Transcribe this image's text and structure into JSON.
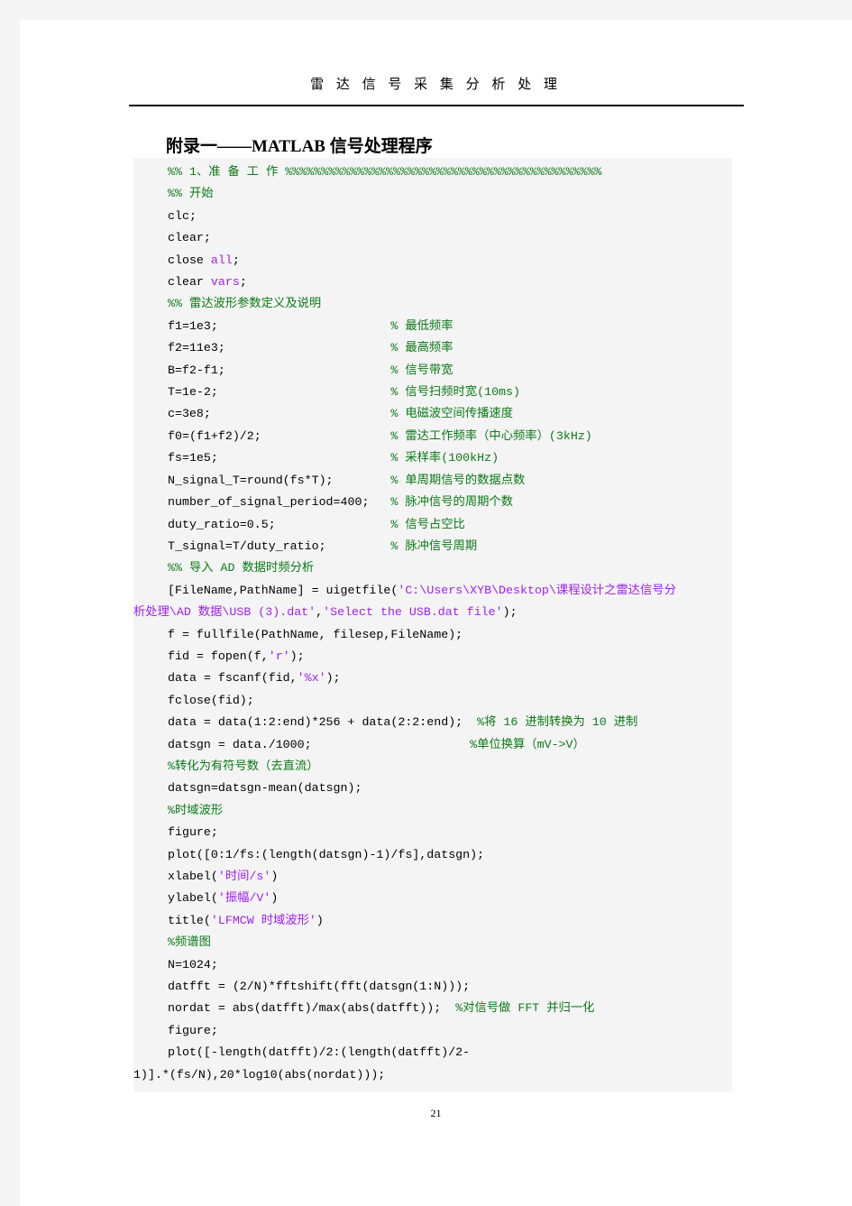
{
  "page": {
    "running_header": "雷 达 信 号 采 集 分 析 处 理",
    "section_title": "附录一——MATLAB 信号处理程序",
    "page_number": "21"
  },
  "colors": {
    "comment_green": "#0b7a17",
    "string_purple": "#a020f0",
    "code_black": "#000000",
    "code_background": "#f4f4f4",
    "page_background": "#ffffff"
  },
  "code": {
    "language": "MATLAB",
    "lines": [
      {
        "id": 1,
        "indent": "normal",
        "segments": [
          {
            "t": "comment",
            "v": "%% 1、准 备 工 作 %%%%%%%%%%%%%%%%%%%%%%%%%%%%%%%%%%%%%%%%%%%%"
          }
        ]
      },
      {
        "id": 2,
        "indent": "normal",
        "segments": [
          {
            "t": "comment",
            "v": "%% 开始"
          }
        ]
      },
      {
        "id": 3,
        "indent": "normal",
        "segments": [
          {
            "t": "code",
            "v": "clc;"
          }
        ]
      },
      {
        "id": 4,
        "indent": "normal",
        "segments": [
          {
            "t": "code",
            "v": "clear;"
          }
        ]
      },
      {
        "id": 5,
        "indent": "normal",
        "segments": [
          {
            "t": "code",
            "v": "close "
          },
          {
            "t": "keyword",
            "v": "all"
          },
          {
            "t": "code",
            "v": ";"
          }
        ]
      },
      {
        "id": 6,
        "indent": "normal",
        "segments": [
          {
            "t": "code",
            "v": "clear "
          },
          {
            "t": "keyword",
            "v": "vars"
          },
          {
            "t": "code",
            "v": ";"
          }
        ]
      },
      {
        "id": 7,
        "indent": "normal",
        "segments": [
          {
            "t": "comment",
            "v": "%% 雷达波形参数定义及说明"
          }
        ]
      },
      {
        "id": 8,
        "indent": "normal",
        "segments": [
          {
            "t": "code",
            "v": "f1=1e3;                        "
          },
          {
            "t": "comment",
            "v": "% 最低频率"
          }
        ]
      },
      {
        "id": 9,
        "indent": "normal",
        "segments": [
          {
            "t": "code",
            "v": "f2=11e3;                       "
          },
          {
            "t": "comment",
            "v": "% 最高频率"
          }
        ]
      },
      {
        "id": 10,
        "indent": "normal",
        "segments": [
          {
            "t": "code",
            "v": "B=f2-f1;                       "
          },
          {
            "t": "comment",
            "v": "% 信号带宽"
          }
        ]
      },
      {
        "id": 11,
        "indent": "normal",
        "segments": [
          {
            "t": "code",
            "v": "T=1e-2;                        "
          },
          {
            "t": "comment",
            "v": "% 信号扫频时宽(10ms)"
          }
        ]
      },
      {
        "id": 12,
        "indent": "normal",
        "segments": [
          {
            "t": "code",
            "v": "c=3e8;                         "
          },
          {
            "t": "comment",
            "v": "% 电磁波空间传播速度"
          }
        ]
      },
      {
        "id": 13,
        "indent": "normal",
        "segments": [
          {
            "t": "code",
            "v": "f0=(f1+f2)/2;                  "
          },
          {
            "t": "comment",
            "v": "% 雷达工作频率（中心频率）(3kHz)"
          }
        ]
      },
      {
        "id": 14,
        "indent": "normal",
        "segments": [
          {
            "t": "code",
            "v": "fs=1e5;                        "
          },
          {
            "t": "comment",
            "v": "% 采样率(100kHz)"
          }
        ]
      },
      {
        "id": 15,
        "indent": "normal",
        "segments": [
          {
            "t": "code",
            "v": "N_signal_T=round(fs*T);        "
          },
          {
            "t": "comment",
            "v": "% 单周期信号的数据点数"
          }
        ]
      },
      {
        "id": 16,
        "indent": "normal",
        "segments": [
          {
            "t": "code",
            "v": "number_of_signal_period=400;   "
          },
          {
            "t": "comment",
            "v": "% 脉冲信号的周期个数"
          }
        ]
      },
      {
        "id": 17,
        "indent": "normal",
        "segments": [
          {
            "t": "code",
            "v": "duty_ratio=0.5;                "
          },
          {
            "t": "comment",
            "v": "% 信号占空比"
          }
        ]
      },
      {
        "id": 18,
        "indent": "normal",
        "segments": [
          {
            "t": "code",
            "v": "T_signal=T/duty_ratio;         "
          },
          {
            "t": "comment",
            "v": "% 脉冲信号周期"
          }
        ]
      },
      {
        "id": 19,
        "indent": "normal",
        "segments": [
          {
            "t": "comment",
            "v": "%% 导入 AD 数据时频分析"
          }
        ]
      },
      {
        "id": 20,
        "indent": "normal",
        "segments": [
          {
            "t": "code",
            "v": "[FileName,PathName] = uigetfile("
          },
          {
            "t": "string",
            "v": "'C:\\Users\\XYB\\Desktop\\课程设计之雷达信号分"
          }
        ]
      },
      {
        "id": 21,
        "indent": "wrap",
        "segments": [
          {
            "t": "string",
            "v": "析处理\\AD 数据\\USB (3).dat'"
          },
          {
            "t": "code",
            "v": ","
          },
          {
            "t": "string",
            "v": "'Select the USB.dat file'"
          },
          {
            "t": "code",
            "v": ");"
          }
        ]
      },
      {
        "id": 22,
        "indent": "normal",
        "segments": [
          {
            "t": "code",
            "v": "f = fullfile(PathName, filesep,FileName);"
          }
        ]
      },
      {
        "id": 23,
        "indent": "normal",
        "segments": [
          {
            "t": "code",
            "v": "fid = fopen(f,"
          },
          {
            "t": "string",
            "v": "'r'"
          },
          {
            "t": "code",
            "v": ");"
          }
        ]
      },
      {
        "id": 24,
        "indent": "normal",
        "segments": [
          {
            "t": "code",
            "v": "data = fscanf(fid,"
          },
          {
            "t": "string",
            "v": "'%x'"
          },
          {
            "t": "code",
            "v": ");"
          }
        ]
      },
      {
        "id": 25,
        "indent": "normal",
        "segments": [
          {
            "t": "code",
            "v": "fclose(fid);"
          }
        ]
      },
      {
        "id": 26,
        "indent": "normal",
        "segments": [
          {
            "t": "code",
            "v": "data = data(1:2:end)*256 + data(2:2:end);  "
          },
          {
            "t": "comment",
            "v": "%将 16 进制转换为 10 进制"
          }
        ]
      },
      {
        "id": 27,
        "indent": "normal",
        "segments": [
          {
            "t": "code",
            "v": "datsgn = data./1000;                      "
          },
          {
            "t": "comment",
            "v": "%单位换算（mV->V）"
          }
        ]
      },
      {
        "id": 28,
        "indent": "normal",
        "segments": [
          {
            "t": "comment",
            "v": "%转化为有符号数（去直流）"
          }
        ]
      },
      {
        "id": 29,
        "indent": "normal",
        "segments": [
          {
            "t": "code",
            "v": "datsgn=datsgn-mean(datsgn);"
          }
        ]
      },
      {
        "id": 30,
        "indent": "normal",
        "segments": [
          {
            "t": "comment",
            "v": "%时域波形"
          }
        ]
      },
      {
        "id": 31,
        "indent": "normal",
        "segments": [
          {
            "t": "code",
            "v": "figure;"
          }
        ]
      },
      {
        "id": 32,
        "indent": "normal",
        "segments": [
          {
            "t": "code",
            "v": "plot([0:1/fs:(length(datsgn)-1)/fs],datsgn);"
          }
        ]
      },
      {
        "id": 33,
        "indent": "normal",
        "segments": [
          {
            "t": "code",
            "v": "xlabel("
          },
          {
            "t": "string",
            "v": "'时间/s'"
          },
          {
            "t": "code",
            "v": ")"
          }
        ]
      },
      {
        "id": 34,
        "indent": "normal",
        "segments": [
          {
            "t": "code",
            "v": "ylabel("
          },
          {
            "t": "string",
            "v": "'振幅/V'"
          },
          {
            "t": "code",
            "v": ")"
          }
        ]
      },
      {
        "id": 35,
        "indent": "normal",
        "segments": [
          {
            "t": "code",
            "v": "title("
          },
          {
            "t": "string",
            "v": "'LFMCW 时域波形'"
          },
          {
            "t": "code",
            "v": ")"
          }
        ]
      },
      {
        "id": 36,
        "indent": "normal",
        "segments": [
          {
            "t": "comment",
            "v": "%频谱图"
          }
        ]
      },
      {
        "id": 37,
        "indent": "normal",
        "segments": [
          {
            "t": "code",
            "v": "N=1024;"
          }
        ]
      },
      {
        "id": 38,
        "indent": "normal",
        "segments": [
          {
            "t": "code",
            "v": "datfft = (2/N)*fftshift(fft(datsgn(1:N)));"
          }
        ]
      },
      {
        "id": 39,
        "indent": "normal",
        "segments": [
          {
            "t": "code",
            "v": "nordat = abs(datfft)/max(abs(datfft));  "
          },
          {
            "t": "comment",
            "v": "%对信号做 FFT 并归一化"
          }
        ]
      },
      {
        "id": 40,
        "indent": "normal",
        "segments": [
          {
            "t": "code",
            "v": "figure;"
          }
        ]
      },
      {
        "id": 41,
        "indent": "normal",
        "segments": [
          {
            "t": "code",
            "v": "plot([-length(datfft)/2:(length(datfft)/2-"
          }
        ]
      },
      {
        "id": 42,
        "indent": "wrap",
        "segments": [
          {
            "t": "code",
            "v": "1)].*(fs/N),20*log10(abs(nordat)));"
          }
        ]
      }
    ]
  }
}
